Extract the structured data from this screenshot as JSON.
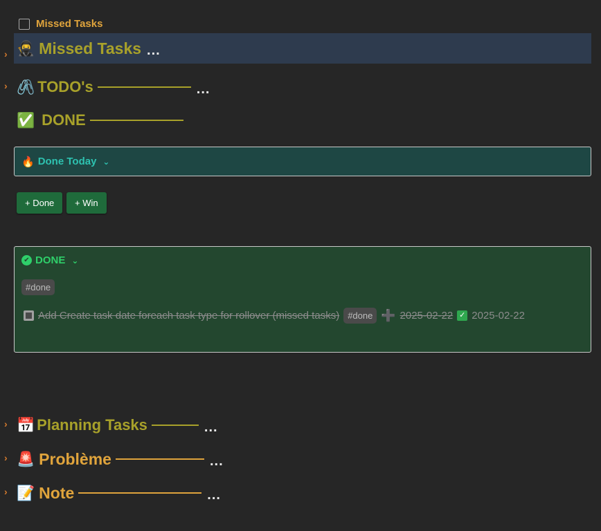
{
  "top_task": {
    "label": "Missed Tasks"
  },
  "headings": {
    "missed": {
      "label": "Missed Tasks",
      "icon": "ninja-icon",
      "dots": "..."
    },
    "todos": {
      "label": "TODO's",
      "icon": "paperclip-icon",
      "dots": "..."
    },
    "done": {
      "label": "DONE",
      "icon": "check-box-icon"
    },
    "planning": {
      "label": "Planning Tasks",
      "icon": "calendar-icon",
      "dots": "..."
    },
    "probleme": {
      "label": "Problème",
      "icon": "siren-icon",
      "dots": "..."
    },
    "note": {
      "label": "Note",
      "icon": "memo-icon",
      "dots": "..."
    }
  },
  "done_today": {
    "title": "Done Today",
    "icon": "fire-icon"
  },
  "buttons": {
    "done": "+ Done",
    "win": "+ Win"
  },
  "done_callout": {
    "title": "DONE",
    "tag": "#done",
    "task": {
      "text": "Add Create task date foreach task type for rollover (missed tasks)",
      "tag": "#done",
      "created_date": "2025-02-22",
      "done_date": "2025-02-22"
    }
  },
  "colors": {
    "background": "#262626",
    "heading_olive": "#a8a12a",
    "heading_orange": "#e0a43c",
    "highlight_row": "#2e3b4e",
    "callout_teal_bg": "#1e4744",
    "callout_green_bg": "#23472f",
    "button_green": "#1f6b3b"
  }
}
